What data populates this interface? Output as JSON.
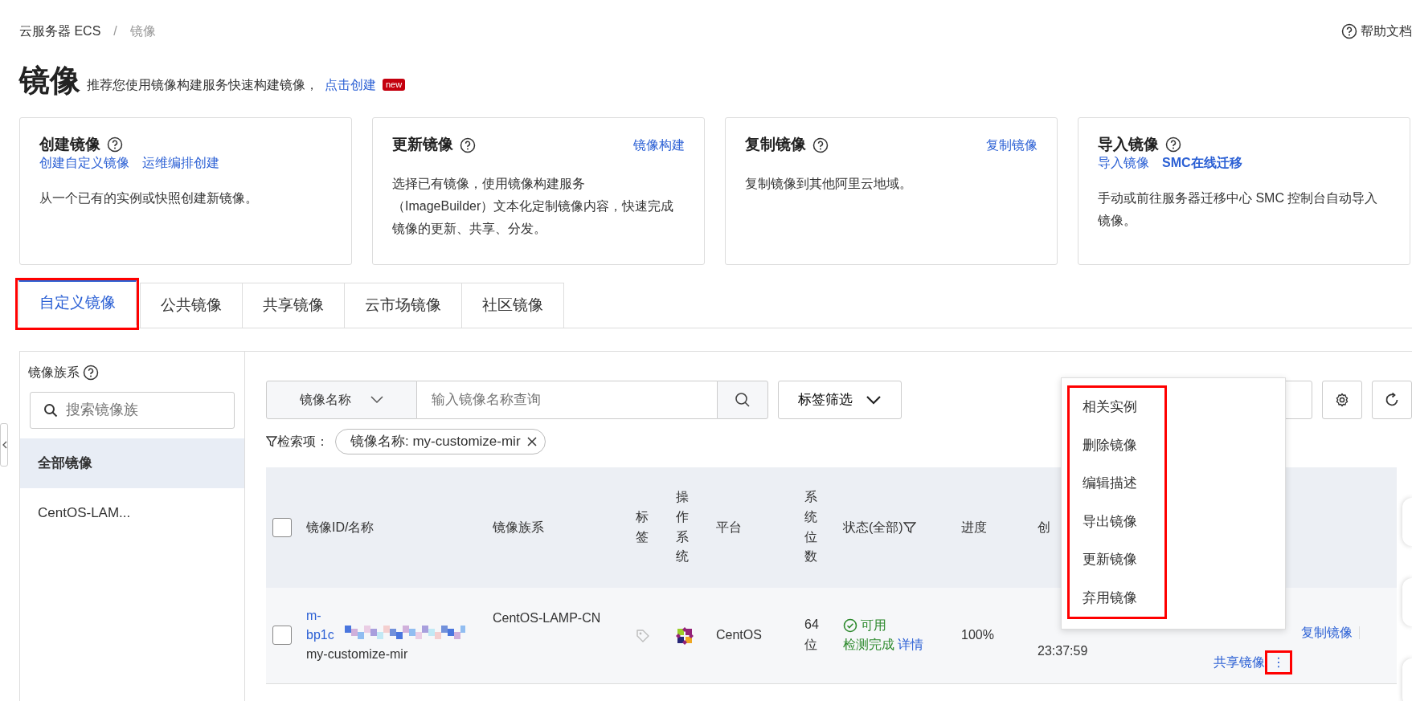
{
  "breadcrumb": {
    "items": [
      "云服务器 ECS",
      "镜像"
    ],
    "separator": "/"
  },
  "help_link": "帮助文档",
  "page": {
    "title": "镜像",
    "subtitle": "推荐您使用镜像构建服务快速构建镜像，",
    "subtitle_link": "点击创建",
    "badge": "new"
  },
  "cards": [
    {
      "title": "创建镜像",
      "links": [
        {
          "label": "创建自定义镜像",
          "emphasis": false
        },
        {
          "label": "运维编排创建",
          "emphasis": false
        }
      ],
      "description": "从一个已有的实例或快照创建新镜像。"
    },
    {
      "title": "更新镜像",
      "header_link": "镜像构建",
      "description": "选择已有镜像，使用镜像构建服务（ImageBuilder）文本化定制镜像内容，快速完成镜像的更新、共享、分发。"
    },
    {
      "title": "复制镜像",
      "header_link": "复制镜像",
      "description": "复制镜像到其他阿里云地域。"
    },
    {
      "title": "导入镜像",
      "links": [
        {
          "label": "导入镜像",
          "emphasis": false
        },
        {
          "label": "SMC在线迁移",
          "emphasis": true
        }
      ],
      "description": "手动或前往服务器迁移中心 SMC 控制台自动导入镜像。"
    }
  ],
  "tabs": [
    {
      "label": "自定义镜像",
      "selected": true,
      "highlighted": true
    },
    {
      "label": "公共镜像",
      "selected": false,
      "highlighted": false
    },
    {
      "label": "共享镜像",
      "selected": false,
      "highlighted": false
    },
    {
      "label": "云市场镜像",
      "selected": false,
      "highlighted": false
    },
    {
      "label": "社区镜像",
      "selected": false,
      "highlighted": false
    }
  ],
  "sidebar": {
    "title": "镜像族系",
    "placeholder": "搜索镜像族",
    "items": [
      {
        "label": "全部镜像",
        "selected": true
      },
      {
        "label": "CentOS-LAM...",
        "selected": false
      }
    ]
  },
  "search": {
    "field_select": "镜像名称",
    "placeholder": "输入镜像名称查询",
    "tag_filter": "标签筛选"
  },
  "filter": {
    "label": "检索项：",
    "chips": [
      "镜像名称: my-customize-mir"
    ]
  },
  "table": {
    "select_all_checked": false,
    "columns": [
      {
        "label": "镜像ID/名称",
        "kind": "text"
      },
      {
        "label": "镜像族系",
        "kind": "text"
      },
      {
        "label": "标签",
        "kind": "vertical"
      },
      {
        "label": "操作系统",
        "kind": "vertical"
      },
      {
        "label": "平台",
        "kind": "text"
      },
      {
        "label": "系统位数",
        "kind": "vertical"
      },
      {
        "label": "状态(全部)",
        "kind": "filter"
      },
      {
        "label": "进度",
        "kind": "text"
      },
      {
        "label": "创",
        "kind": "text"
      }
    ],
    "rows": [
      {
        "checked": false,
        "id": "m-bp1c",
        "name": "my-customize-mir",
        "family": "CentOS-LAMP-CN",
        "platform": "CentOS",
        "bits": "64位",
        "status": "可用",
        "check": "检测完成",
        "detail": "详情",
        "progress": "100%",
        "time": "23:37:59",
        "actions": [
          "复制镜像",
          "共享镜像"
        ],
        "more": {
          "label": "⋮",
          "highlighted": true
        }
      }
    ]
  },
  "row_menu": {
    "highlighted": true,
    "items": [
      "相关实例",
      "删除镜像",
      "编辑描述",
      "导出镜像",
      "更新镜像",
      "弃用镜像"
    ]
  }
}
